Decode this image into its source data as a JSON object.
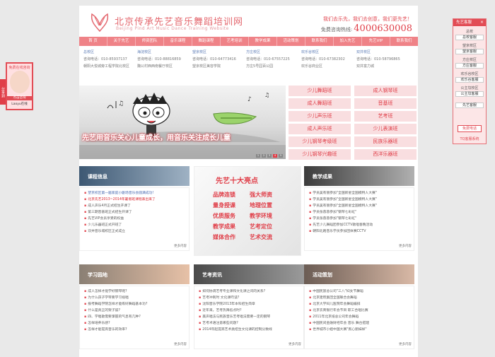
{
  "header": {
    "brand_cn": "北京传承先艺音乐舞蹈培训网",
    "brand_en": "Beijing Pind Art Music Dance Training Website",
    "slogan": "我们去乐先，我们去创意，我们更先艺！",
    "hotline_label": "免费咨询热线:",
    "hotline_number": "4000630008"
  },
  "nav": [
    "首 页",
    "关于先艺",
    "师资团队",
    "音乐课程",
    "舞蹈课程",
    "艺考培训",
    "教学成果",
    "活动策划",
    "联系我们",
    "加入先艺",
    "先艺VIP",
    "联系我们"
  ],
  "schools": [
    {
      "name": "总校区",
      "phone": "咨询电话：010-85937137",
      "address": "朝阳大悦城旁工程学院北校区"
    },
    {
      "name": "海淀校区",
      "phone": "咨询电话：010-88816859",
      "address": "魏公村西西南餐厅校区"
    },
    {
      "name": "望京校区",
      "phone": "咨询电话：010-64773416",
      "address": "望京校区美容学院"
    },
    {
      "name": "方庄校区",
      "phone": "咨询电话：010-67557225",
      "address": "方庄5号园百公园"
    },
    {
      "name": "欢乐谷校区",
      "phone": "咨询电话：010-67382302",
      "address": "欢乐谷商业区"
    },
    {
      "name": "双井校区",
      "phone": "咨询电话：010-58796865",
      "address": "双井富力城"
    }
  ],
  "banner": {
    "caption": "先艺用音乐关心儿童成长，用音乐关注成长儿童",
    "pages": [
      "1",
      "2",
      "3",
      "4",
      "5"
    ]
  },
  "courses": [
    "少儿舞蹈班",
    "成人钢琴班",
    "成人舞蹈班",
    "音基班",
    "少儿声乐班",
    "艺考班",
    "成人声乐班",
    "少儿表演班",
    "少儿钢琴考级班",
    "民族乐器班",
    "少儿钢琴兴趣班",
    "西洋乐器班"
  ],
  "panels": {
    "course_info": {
      "title": "课程信息",
      "items": [
        "望京校区第一届家庭小剧场音乐会圆满成功!",
        "北京先艺2013~2014年暑假班课程表出来了",
        "成人声乐4月正式招生开课了",
        "第三期音基班正式招生开课了",
        "先艺VIP会员享受的权益",
        "少儿乐器班正式开班了",
        "双井音乐城校区正式成立"
      ],
      "more": "更多内容"
    },
    "results": {
      "title": "教学成果",
      "items": [
        "学员吴有丽参加\"全国新星全国模特人大赛\"",
        "学员吴有丽参加\"全国新星全国模特人大赛\"",
        "学员吴有丽参加\"全国新星全国模特人大赛\"",
        "学员张蓉蓉参加\"钢琴七彩虹\"",
        "学员张蓉蓉参加\"钢琴七彩虹\"",
        "先艺少儿舞蹈团参加CCTV歌唱春晚活动",
        "朝阳北路音乐学员参加团体赛CCTV"
      ],
      "more": "更多内容"
    },
    "campus": {
      "title": "学习园地",
      "items": [
        "成人怎样才能学好钢琴呢?",
        "为什么孩子学琴要学习视唱",
        "报考舞蹈学院怎样才能练好舞蹈基本功?",
        "什么是真正的架子鼓?",
        "四、学唱歌需要掌握的气息有几种?",
        "怎样培养乐感?",
        "怎样才能提高音乐的效率?"
      ],
      "more": "更多内容"
    },
    "news": {
      "title": "艺考资讯",
      "items": [
        "如何协调艺考专业课和文化课之间的关系?",
        "艺考冲刺时 文化课咋读?",
        "沈阳音乐学院2013年本科招生简章",
        "近年来，艺考热降低点时?",
        "美声唱法与民族音乐艺考唱法需要一定的钢琴",
        "艺考术语注意哪些问题?",
        "2014年起提高艺术类招生文化课的控制分数线"
      ],
      "more": "更多内容"
    },
    "events": {
      "title": "活动策划",
      "items": [
        "中国民族总公司\"三八\"妇女节舞蹈",
        "北京建筑集团全国联合会舞蹈",
        "北京大学妇儿医院年会舞蹈编排",
        "北京农商银行年会节目 职工合唱比赛",
        "2011年北京纸总公司年会舞蹈",
        "中国民间金融财经年会 音乐 舞台搭建",
        "世界城市小姐中国大赛\"民心丽妹样\""
      ],
      "more": "更多内容"
    }
  },
  "highlights": {
    "title": "先艺十大亮点",
    "items": [
      "品牌连锁",
      "强大师资",
      "量身授课",
      "地理位置",
      "优质服务",
      "教学环境",
      "教学成果",
      "艺考定位",
      "媒体合作",
      "艺术交流"
    ]
  },
  "left_float": {
    "top": "免费在线咨询",
    "label": "点击咨询",
    "name": "Laoyu在线",
    "tab": "分享到"
  },
  "right_float": {
    "title": "先艺客服",
    "close": "×",
    "sections": [
      {
        "name": "总校",
        "qq": "总校客服"
      },
      {
        "name": "望京校区",
        "qq": "望京客服"
      },
      {
        "name": "方庄校区",
        "qq": "方庄客服"
      },
      {
        "name": "欢乐谷校区",
        "qq": "欢乐谷客服"
      },
      {
        "name": "公主坟校区",
        "qq": "公主坟客服"
      },
      {
        "name": "",
        "qq": "先艺客服"
      }
    ],
    "button": "免费电话",
    "footer": "TQ客服系统"
  },
  "colors": {
    "accent": "#e24c55",
    "nav": "#ef8287",
    "course_bg": "#f9dee0",
    "link_blue": "#4a6bb2"
  }
}
